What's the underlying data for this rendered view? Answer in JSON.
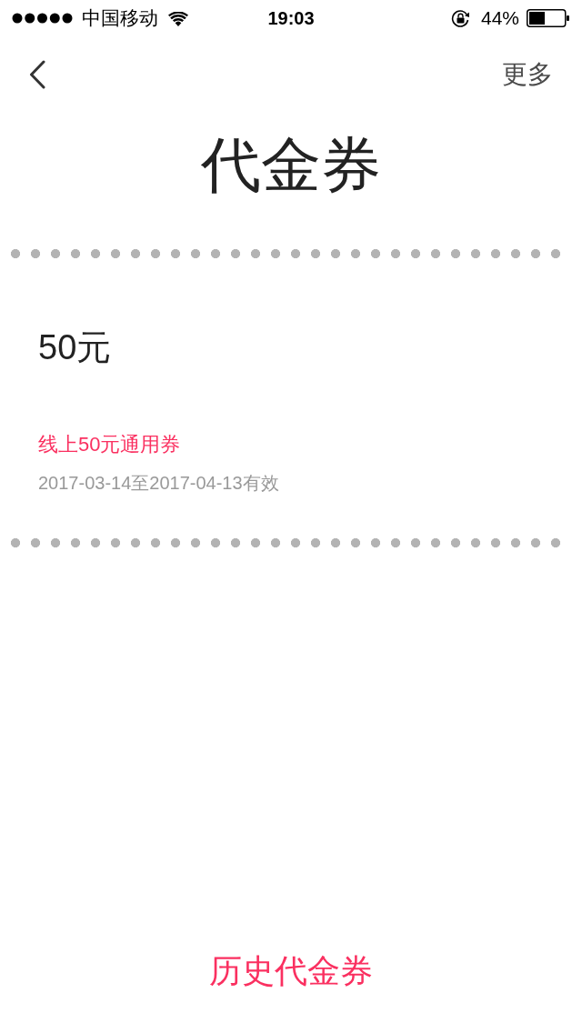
{
  "status_bar": {
    "carrier": "中国移动",
    "time": "19:03",
    "battery": "44%"
  },
  "nav": {
    "more": "更多"
  },
  "title": "代金券",
  "vouchers": [
    {
      "amount": "50元",
      "name": "线上50元通用券",
      "validity": "2017-03-14至2017-04-13有效"
    }
  ],
  "history_link": "历史代金券"
}
